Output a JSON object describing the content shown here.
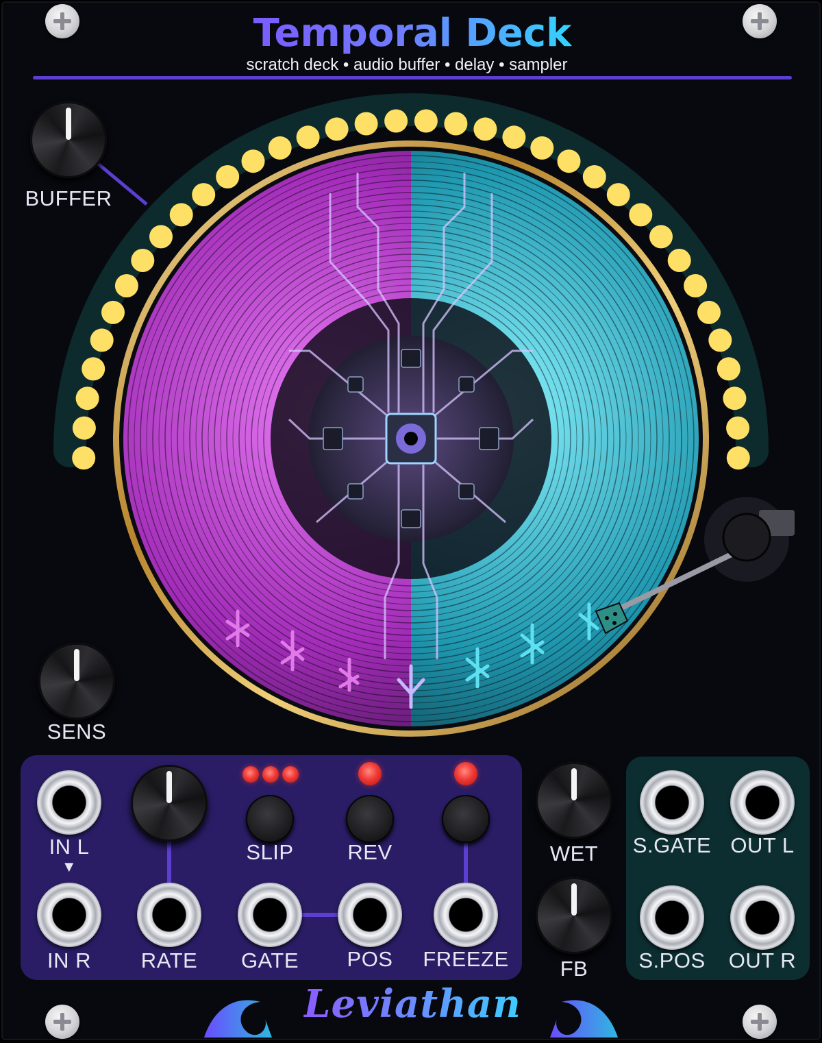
{
  "header": {
    "title": "Temporal Deck",
    "subtitle": "scratch deck • audio buffer • delay • sampler"
  },
  "controls": {
    "buffer_label": "BUFFER",
    "sens_label": "SENS",
    "wet_label": "WET",
    "fb_label": "FB",
    "rate_label": "RATE"
  },
  "buttons": {
    "slip_label": "SLIP",
    "rev_label": "REV",
    "freeze_label": "FREEZE"
  },
  "jacks": {
    "in_l": "IN L",
    "in_r": "IN R",
    "rate": "RATE",
    "gate": "GATE",
    "pos": "POS",
    "freeze": "FREEZE",
    "s_gate": "S.GATE",
    "out_l": "OUT L",
    "s_pos": "S.POS",
    "out_r": "OUT R"
  },
  "in_arrow": "▼",
  "brand": "Leviathan",
  "buffer_meter": {
    "total_leds": 36,
    "lit_leds": 36
  },
  "colors": {
    "accent": "#5b3fd0",
    "input_panel": "#2a1d66",
    "output_panel": "#0c2e30",
    "led_yellow": "#ffe066",
    "led_red": "#f03a36",
    "record_left": "#c23cd6",
    "record_right": "#2bc4d8",
    "rim_gold": "#c9a24a"
  },
  "icons": {
    "screws": "screw-icon",
    "input_arrow": "down-arrow-icon",
    "wave_left": "wave-icon",
    "wave_right": "wave-icon"
  }
}
